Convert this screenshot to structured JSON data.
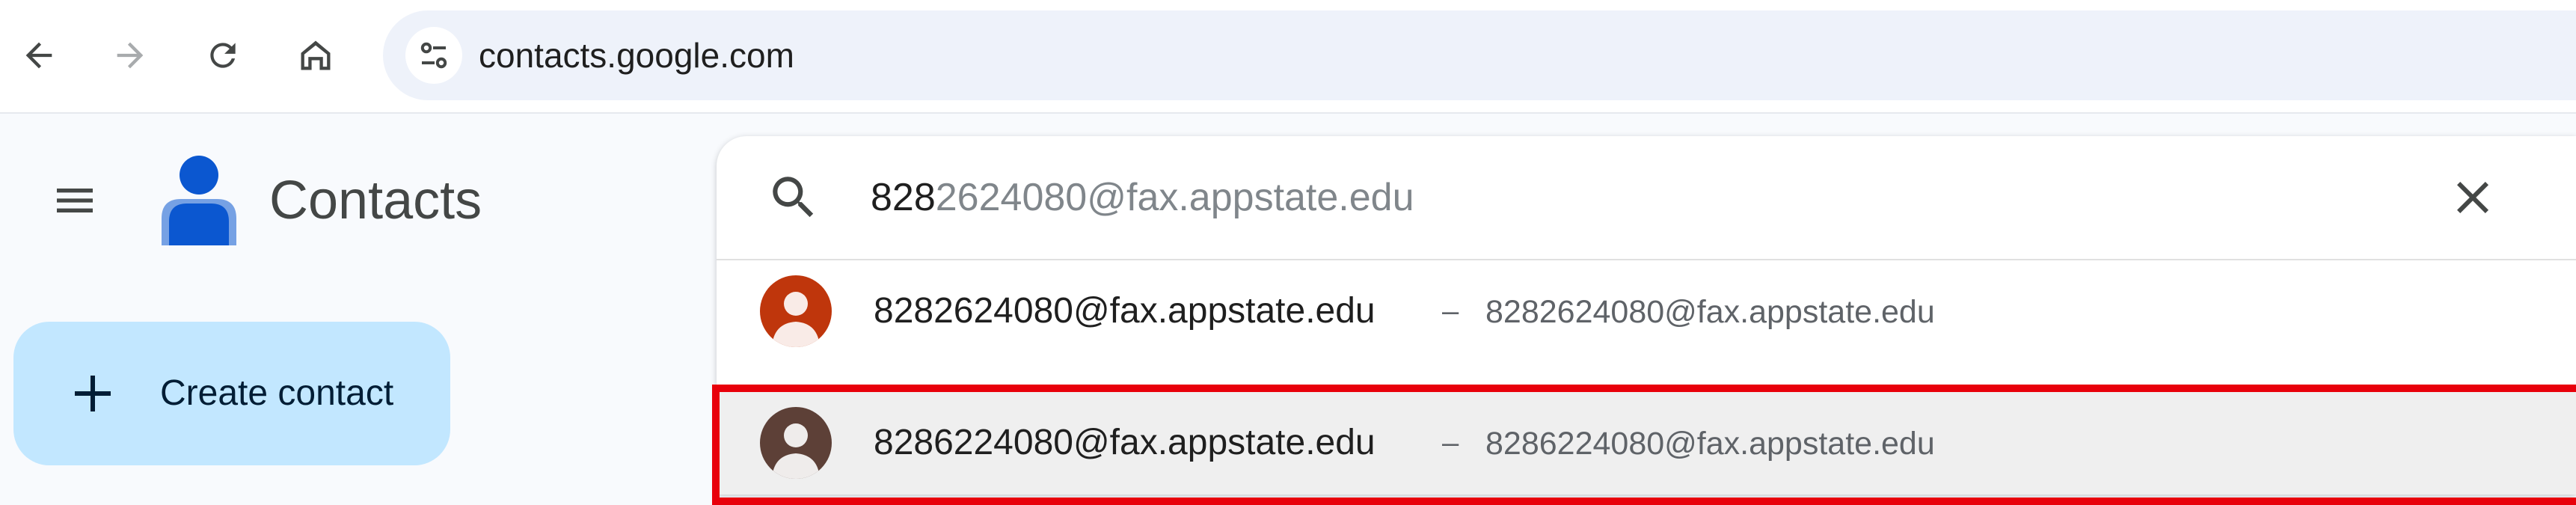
{
  "browser": {
    "url": "contacts.google.com",
    "icons": [
      "back-arrow-icon",
      "forward-arrow-icon",
      "reload-icon",
      "home-icon",
      "site-settings-icon"
    ]
  },
  "app": {
    "title": "Contacts",
    "logo": "contacts-person-logo",
    "menu_icon": "hamburger-menu-icon"
  },
  "create_contact": {
    "label": "Create contact",
    "icon": "plus-icon"
  },
  "search": {
    "typed": "828",
    "completion": "2624080@fax.appstate.edu",
    "search_icon": "search-icon",
    "clear_icon": "close-icon"
  },
  "results": [
    {
      "name": "8282624080@fax.appstate.edu",
      "separator": "–",
      "email": "8282624080@fax.appstate.edu",
      "avatar_color": "#bf360c"
    },
    {
      "name": "8286224080@fax.appstate.edu",
      "separator": "–",
      "email": "8286224080@fax.appstate.edu",
      "avatar_color": "#5d4037",
      "highlighted": true
    }
  ],
  "colors": {
    "highlight_border": "#e8000b",
    "create_button_bg": "#c2e7ff",
    "logo_blue": "#0b57d0"
  }
}
